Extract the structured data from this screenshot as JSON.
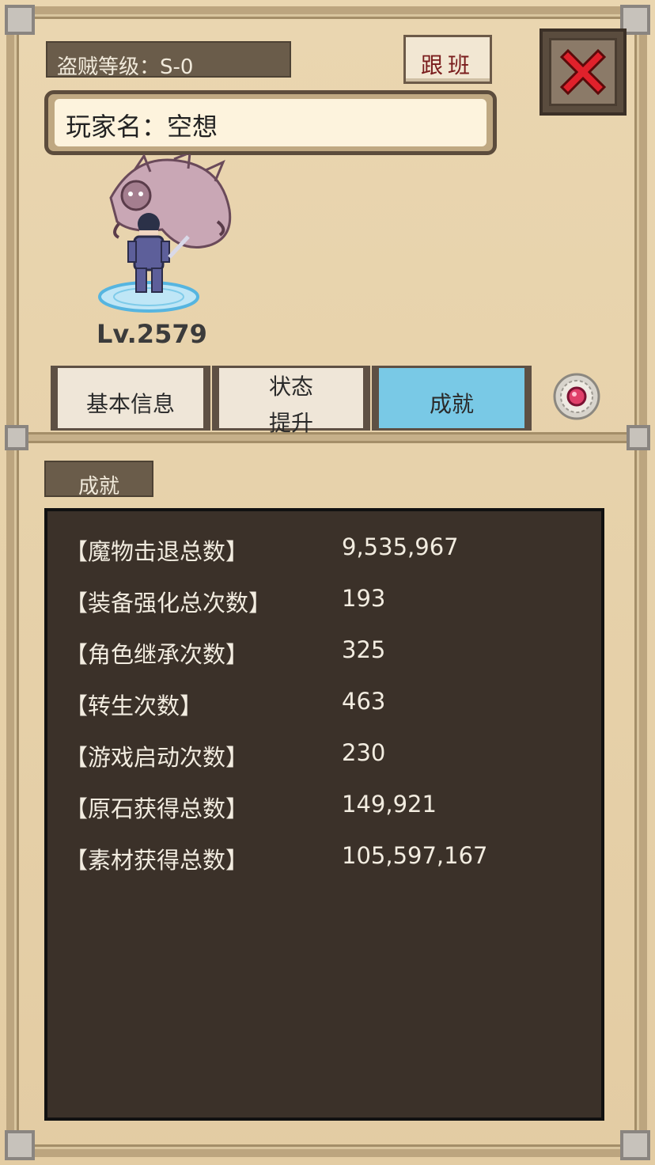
{
  "header": {
    "thief_rank": "盗贼等级：S-0",
    "follow_label": "跟班",
    "close_icon": "close-icon",
    "player_name": "玩家名：空想"
  },
  "character": {
    "level": "Lv.2579"
  },
  "tabs": [
    {
      "label": "基本信息"
    },
    {
      "label_line1": "状态",
      "label_line2": "提升"
    },
    {
      "label": "成就"
    }
  ],
  "section": {
    "title": "成就"
  },
  "achievements": [
    {
      "name": "【魔物击退总数】",
      "value": "9,535,967"
    },
    {
      "name": "【装备强化总次数】",
      "value": "193"
    },
    {
      "name": "【角色继承次数】",
      "value": "325"
    },
    {
      "name": "【转生次数】",
      "value": "463"
    },
    {
      "name": "【游戏启动次数】",
      "value": "230"
    },
    {
      "name": "【原石获得总数】",
      "value": "149,921"
    },
    {
      "name": "【素材获得总数】",
      "value": "105,597,167"
    }
  ],
  "colors": {
    "active_tab": "#79c9e6",
    "panel_bg": "#3b3129",
    "close_red": "#e0212b"
  }
}
